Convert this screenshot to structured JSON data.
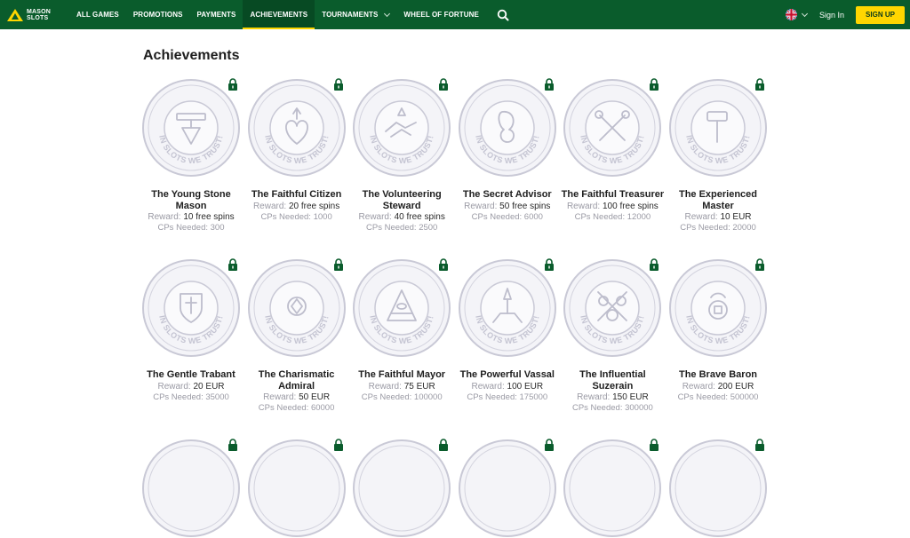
{
  "brand": {
    "line1": "MASON",
    "line2": "SLOTS"
  },
  "nav": {
    "items": [
      {
        "label": "ALL GAMES",
        "name": "nav-all-games"
      },
      {
        "label": "PROMOTIONS",
        "name": "nav-promotions"
      },
      {
        "label": "PAYMENTS",
        "name": "nav-payments"
      },
      {
        "label": "ACHIEVEMENTS",
        "name": "nav-achievements",
        "active": true
      },
      {
        "label": "TOURNAMENTS",
        "name": "nav-tournaments",
        "dropdown": true
      },
      {
        "label": "WHEEL OF FORTUNE",
        "name": "nav-wheel-of-fortune"
      }
    ],
    "sign_in": "Sign In",
    "sign_up": "SIGN UP"
  },
  "colors": {
    "nav_bg": "#0a5c2c",
    "accent": "#ffd600",
    "lock": "#0a5c2c",
    "medal": "#c9c9d6"
  },
  "page": {
    "title": "Achievements"
  },
  "labels": {
    "reward": "Reward:",
    "cps": "CPs Needed:"
  },
  "medal_text": "IN SLOTS WE TRUST!",
  "achievements": [
    {
      "name": "The Young Stone Mason",
      "reward": "10 free spins",
      "cps": "300",
      "emblem": "trowel-icon"
    },
    {
      "name": "The Faithful Citizen",
      "reward": "20 free spins",
      "cps": "1000",
      "emblem": "sacred-heart-icon"
    },
    {
      "name": "The Volunteering Steward",
      "reward": "40 free spins",
      "cps": "2500",
      "emblem": "handshake-icon"
    },
    {
      "name": "The Secret Advisor",
      "reward": "50 free spins",
      "cps": "6000",
      "emblem": "mask-icon"
    },
    {
      "name": "The Faithful Treasurer",
      "reward": "100 free spins",
      "cps": "12000",
      "emblem": "crossed-keys-icon"
    },
    {
      "name": "The Experienced Master",
      "reward": "10 EUR",
      "cps": "20000",
      "emblem": "gavel-icon"
    },
    {
      "name": "The Gentle Trabant",
      "reward": "20 EUR",
      "cps": "35000",
      "emblem": "shield-icon"
    },
    {
      "name": "The Charismatic Admiral",
      "reward": "50 EUR",
      "cps": "60000",
      "emblem": "laurel-emblem-icon"
    },
    {
      "name": "The Faithful Mayor",
      "reward": "75 EUR",
      "cps": "100000",
      "emblem": "pyramid-eye-icon"
    },
    {
      "name": "The Powerful Vassal",
      "reward": "100 EUR",
      "cps": "175000",
      "emblem": "temple-icon"
    },
    {
      "name": "The Influential Suzerain",
      "reward": "150 EUR",
      "cps": "300000",
      "emblem": "coins-icon"
    },
    {
      "name": "The Brave Baron",
      "reward": "200 EUR",
      "cps": "500000",
      "emblem": "crest-icon"
    }
  ]
}
